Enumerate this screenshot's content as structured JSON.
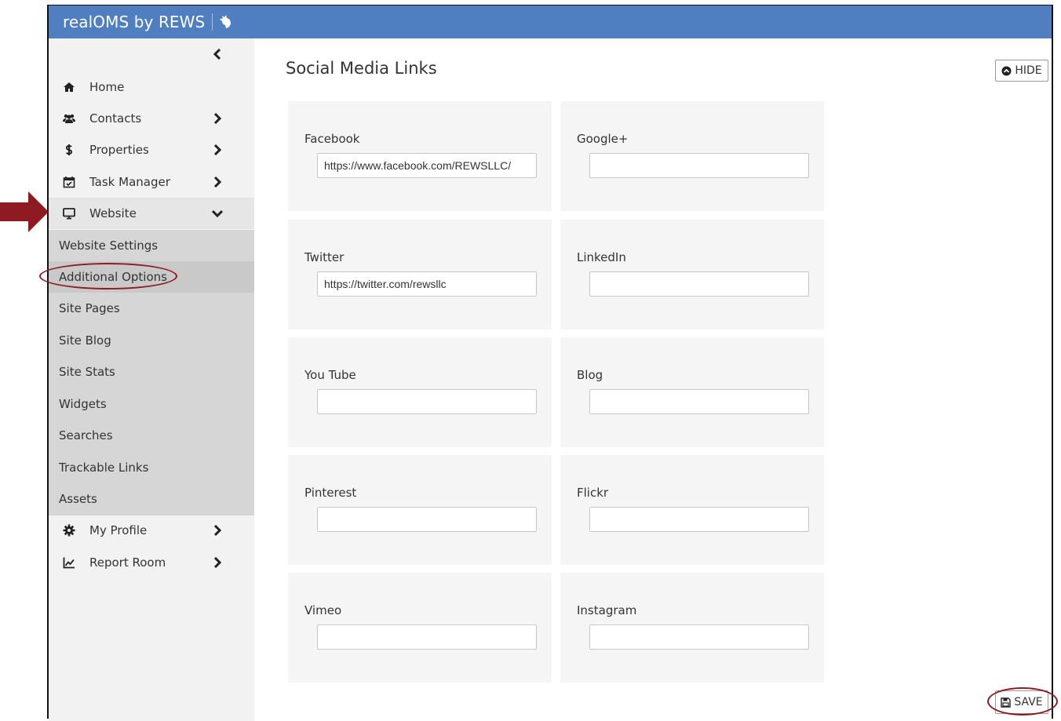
{
  "app": {
    "brand": "realOMS by REWS"
  },
  "sidebar": {
    "items": [
      {
        "label": "Home",
        "icon": "home-icon"
      },
      {
        "label": "Contacts",
        "icon": "users-icon"
      },
      {
        "label": "Properties",
        "icon": "dollar-icon"
      },
      {
        "label": "Task Manager",
        "icon": "calendar-check-icon"
      },
      {
        "label": "Website",
        "icon": "desktop-icon"
      },
      {
        "label": "My Profile",
        "icon": "gear-icon"
      },
      {
        "label": "Report Room",
        "icon": "line-chart-icon"
      }
    ],
    "website_submenu": [
      "Website Settings",
      "Additional Options",
      "Site Pages",
      "Site Blog",
      "Site Stats",
      "Widgets",
      "Searches",
      "Trackable Links",
      "Assets"
    ]
  },
  "main": {
    "title": "Social Media Links",
    "hide_label": "HIDE",
    "save_label": "SAVE",
    "fields": [
      {
        "label": "Facebook",
        "value": "https://www.facebook.com/REWSLLC/"
      },
      {
        "label": "Google+",
        "value": ""
      },
      {
        "label": "Twitter",
        "value": "https://twitter.com/rewsllc"
      },
      {
        "label": "LinkedIn",
        "value": ""
      },
      {
        "label": "You Tube",
        "value": ""
      },
      {
        "label": "Blog",
        "value": ""
      },
      {
        "label": "Pinterest",
        "value": ""
      },
      {
        "label": "Flickr",
        "value": ""
      },
      {
        "label": "Vimeo",
        "value": ""
      },
      {
        "label": "Instagram",
        "value": ""
      }
    ]
  },
  "colors": {
    "topbar": "#4f7fc1",
    "annotation": "#8e1a22",
    "submenu_bg": "#d6d6d6",
    "sidebar_bg": "#f2f2f2"
  }
}
